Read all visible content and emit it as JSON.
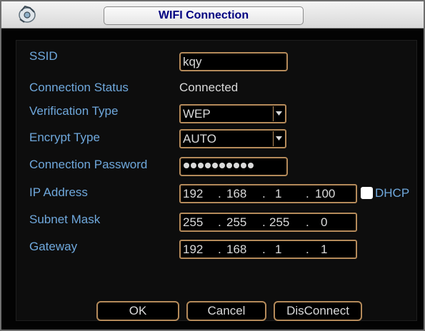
{
  "window": {
    "title": "WIFI Connection",
    "icon": "dvr-logo-icon"
  },
  "form": {
    "ssid": {
      "label": "SSID",
      "value": "kqy"
    },
    "status": {
      "label": "Connection Status",
      "value": "Connected"
    },
    "verification": {
      "label": "Verification Type",
      "value": "WEP"
    },
    "encrypt": {
      "label": "Encrypt Type",
      "value": "AUTO"
    },
    "password": {
      "label": "Connection Password",
      "masked_length": 10
    },
    "ip": {
      "label": "IP Address",
      "octets": [
        "192",
        "168",
        "1",
        "100"
      ]
    },
    "subnet": {
      "label": "Subnet Mask",
      "octets": [
        "255",
        "255",
        "255",
        "0"
      ]
    },
    "gateway": {
      "label": "Gateway",
      "octets": [
        "192",
        "168",
        "1",
        "1"
      ]
    },
    "dhcp": {
      "label": "DHCP",
      "checked": false
    }
  },
  "buttons": {
    "ok": "OK",
    "cancel": "Cancel",
    "disconnect": "DisConnect"
  },
  "colors": {
    "label": "#6fa8dc",
    "field_border": "#b48a5a",
    "title_text": "#000080",
    "background": "#000000"
  }
}
